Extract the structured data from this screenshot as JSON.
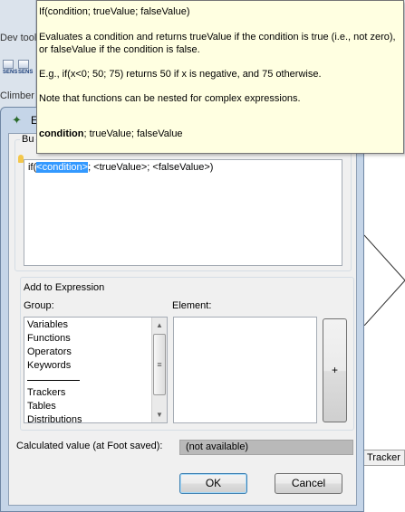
{
  "background": {
    "devtool_label": "Dev tool",
    "sens_labels": [
      "SENS",
      "SENS"
    ],
    "climber_label": "Climber",
    "tracker_label": "Tracker"
  },
  "dialog": {
    "title": "E",
    "builder_title": "Bu",
    "expression": {
      "prefix": "if(",
      "selected": "<condition>",
      "suffix": "; <trueValue>; <falseValue>)"
    },
    "add_group_title": "Add to Expression",
    "group_label": "Group:",
    "element_label": "Element:",
    "groups_top": [
      "Variables",
      "Functions",
      "Operators",
      "Keywords"
    ],
    "groups_bottom": [
      "Trackers",
      "Tables",
      "Distributions"
    ],
    "insert_button": "+",
    "calc_label": "Calculated value (at Foot saved):",
    "calc_value": "(not available)",
    "ok_label": "OK",
    "cancel_label": "Cancel"
  },
  "tooltip": {
    "signature": "If(condition; trueValue; falseValue)",
    "description": "Evaluates a condition and returns trueValue if the condition is true (i.e., not zero), or falseValue if the condition is false.",
    "example": "E.g., if(x<0; 50; 75) returns 50 if x is negative, and 75 otherwise.",
    "note": "Note that functions can be nested for complex expressions.",
    "param_bold": "condition",
    "param_rest": "; trueValue; falseValue"
  },
  "colors": {
    "selection": "#3399ff",
    "tooltip_bg": "#ffffe1",
    "titlebar": "#c5d5e8"
  }
}
